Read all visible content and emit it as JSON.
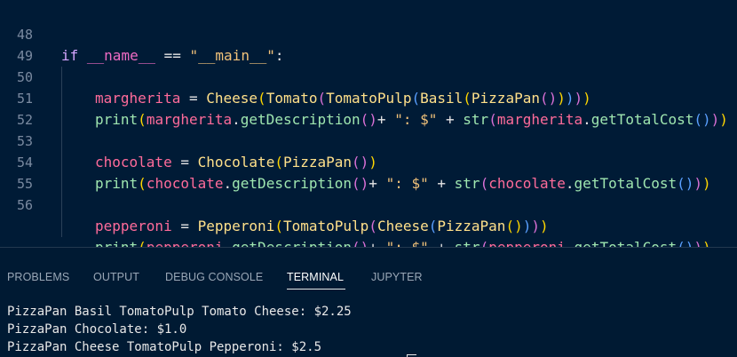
{
  "editor": {
    "lines": [
      {
        "number": "48",
        "text": "if __name__ == \"__main__\":"
      },
      {
        "number": "49",
        "text": "margherita = Cheese(Tomato(TomatoPulp(Basil(PizzaPan()))))"
      },
      {
        "number": "50",
        "text": "print(margherita.getDescription()+ \": $\" + str(margherita.getTotalCost()))"
      },
      {
        "number": "51",
        "text": ""
      },
      {
        "number": "52",
        "text": "chocolate = Chocolate(PizzaPan())"
      },
      {
        "number": "53",
        "text": "print(chocolate.getDescription()+ \": $\" + str(chocolate.getTotalCost()))"
      },
      {
        "number": "54",
        "text": ""
      },
      {
        "number": "55",
        "text": "pepperoni = Pepperoni(TomatoPulp(Cheese(PizzaPan())))"
      },
      {
        "number": "56",
        "text": "print(pepperoni.getDescription()+ \": $\" + str(pepperoni.getTotalCost()))"
      }
    ]
  },
  "panel": {
    "tabs": [
      {
        "label": "PROBLEMS",
        "active": false
      },
      {
        "label": "OUTPUT",
        "active": false
      },
      {
        "label": "DEBUG CONSOLE",
        "active": false
      },
      {
        "label": "TERMINAL",
        "active": true
      },
      {
        "label": "JUPYTER",
        "active": false
      }
    ],
    "terminal": [
      "PizzaPan Basil TomatoPulp Tomato Cheese: $2.25",
      "PizzaPan Chocolate: $1.0",
      "PizzaPan Cheese TomatoPulp Pepperoni: $2.5"
    ]
  },
  "colors": {
    "editor_background": "#001b36",
    "panel_background": "#001a33",
    "line_number": "#7a8aa0",
    "keyword": "#d6a6ff",
    "string": "#f2c27a",
    "variable": "#ff6b9a",
    "class_name": "#ffe08a",
    "method": "#9fe6b0"
  }
}
